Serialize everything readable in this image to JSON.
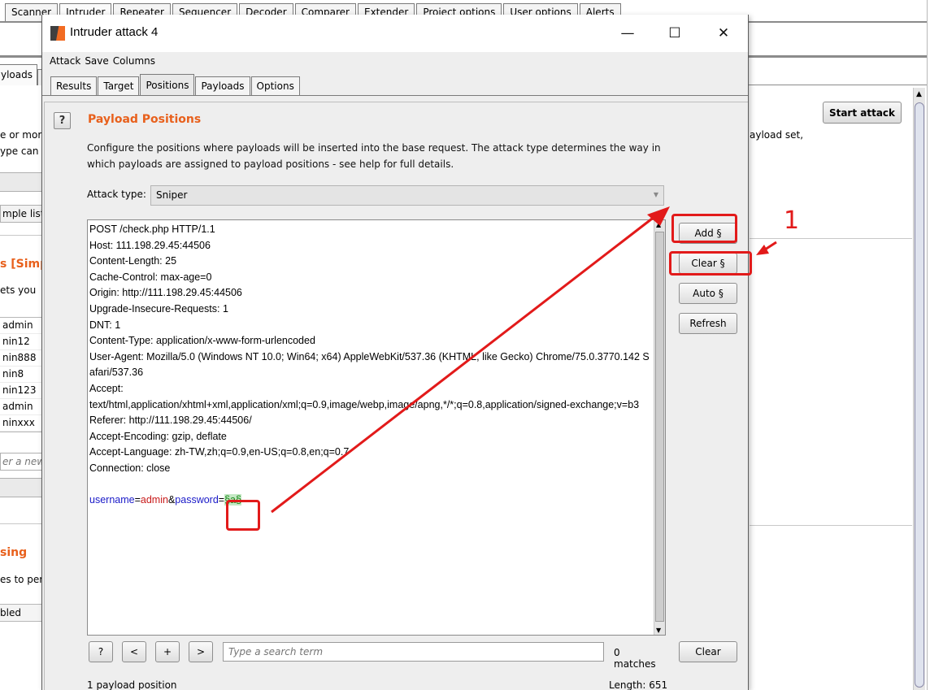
{
  "main_window": {
    "tabs": [
      {
        "label": "Scanner"
      },
      {
        "label": "Intruder"
      },
      {
        "label": "Repeater"
      },
      {
        "label": "Sequencer"
      },
      {
        "label": "Decoder"
      },
      {
        "label": "Comparer"
      },
      {
        "label": "Extender"
      },
      {
        "label": "Project options"
      },
      {
        "label": "User options"
      },
      {
        "label": "Alerts"
      }
    ],
    "sub_tab": "yloads",
    "start_attack_label": "Start attack",
    "fragments": {
      "more": "e or more",
      "type_can": "ype can",
      "payload_set": "ayload set,",
      "simple_list": "mple list",
      "simp_header": "s [Simp",
      "lets_you": "ets you",
      "new_item": "er a new",
      "sing_header": "sing",
      "es_to_perf": "es to perf",
      "enabled": "bled"
    },
    "list_items": [
      "admin",
      "nin12",
      "nin888",
      "nin8",
      "nin123",
      "admin",
      "ninxxx"
    ]
  },
  "dialog": {
    "title": "Intruder attack 4",
    "controls": {
      "minimize": "—",
      "maximize": "☐",
      "close": "✕"
    },
    "menu": [
      "Attack",
      "Save",
      "Columns"
    ],
    "tabs": [
      {
        "label": "Results"
      },
      {
        "label": "Target"
      },
      {
        "label": "Positions"
      },
      {
        "label": "Payloads"
      },
      {
        "label": "Options"
      }
    ],
    "help_icon": "?",
    "section_title": "Payload Positions",
    "description": "Configure the positions where payloads will be inserted into the base request. The attack type determines the way in which payloads are assigned to payload positions - see help for full details.",
    "attack_type_label": "Attack type:",
    "attack_type_value": "Sniper",
    "request_lines": [
      "POST /check.php HTTP/1.1",
      "Host: 111.198.29.45:44506",
      "Content-Length: 25",
      "Cache-Control: max-age=0",
      "Origin: http://111.198.29.45:44506",
      "Upgrade-Insecure-Requests: 1",
      "DNT: 1",
      "Content-Type: application/x-www-form-urlencoded",
      "User-Agent: Mozilla/5.0 (Windows NT 10.0; Win64; x64) AppleWebKit/537.36 (KHTML, like Gecko) Chrome/75.0.3770.142 Safari/537.36",
      "Accept:",
      "text/html,application/xhtml+xml,application/xml;q=0.9,image/webp,image/apng,*/*;q=0.8,application/signed-exchange;v=b3",
      "Referer: http://111.198.29.45:44506/",
      "Accept-Encoding: gzip, deflate",
      "Accept-Language: zh-TW,zh;q=0.9,en-US;q=0.8,en;q=0.7",
      "Connection: close"
    ],
    "body": {
      "k1": "username",
      "eq1": "=",
      "v1": "admin",
      "amp": "&",
      "k2": "password",
      "eq2": "=",
      "marker": "§a§"
    },
    "side_buttons": {
      "add": "Add §",
      "clear": "Clear §",
      "auto": "Auto §",
      "refresh": "Refresh"
    },
    "search": {
      "help": "?",
      "prev": "<",
      "add": "+",
      "next": ">",
      "placeholder": "Type a search term",
      "matches": "0 matches",
      "clear": "Clear"
    },
    "status_positions": "1 payload position",
    "status_length": "Length: 651"
  },
  "annotation": {
    "number": "1",
    "color": "#e21a1a"
  }
}
